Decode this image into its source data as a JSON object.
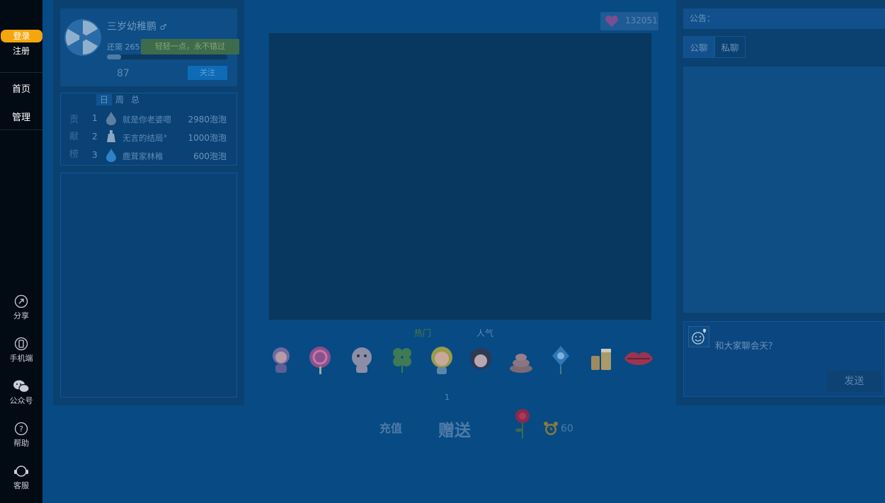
{
  "nav": {
    "login": "登录",
    "register": "注册",
    "home": "首页",
    "manage": "管理",
    "share": "分享",
    "mobile": "手机端",
    "wechat": "公众号",
    "help": "帮助",
    "service": "客服"
  },
  "anchor": {
    "name": "三岁幼稚鹏",
    "need_prefix": "还需 265",
    "tooltip": "轻轻一点，永不错过",
    "progress_fraction": 0.12,
    "level": "87",
    "follow_label": "关注"
  },
  "rank": {
    "tabs": [
      "日",
      "周",
      "总"
    ],
    "label_chars": [
      "贡",
      "献",
      "榜"
    ],
    "rows": [
      {
        "no": "1",
        "name": "就是你老婆嗯",
        "points": "2980泡泡"
      },
      {
        "no": "2",
        "name": "无言的结局°",
        "points": "1000泡泡"
      },
      {
        "no": "3",
        "name": "鹿茸家林稚",
        "points": "600泡泡"
      }
    ]
  },
  "coins": {
    "value": "132051"
  },
  "gifts": {
    "tabs": [
      "热门",
      "人气"
    ],
    "page": "1",
    "recharge": "充值",
    "send": "赠送",
    "timer": "60",
    "items": [
      "girl-doll",
      "lollipop",
      "tiger-cub",
      "clover",
      "blonde-girl",
      "devil-cat",
      "poop",
      "balloon",
      "beer",
      "lips"
    ]
  },
  "chat": {
    "announce": "公告：",
    "tabs": [
      "公聊",
      "私聊"
    ],
    "placeholder": "和大家聊会天？",
    "send_label": "发送"
  }
}
